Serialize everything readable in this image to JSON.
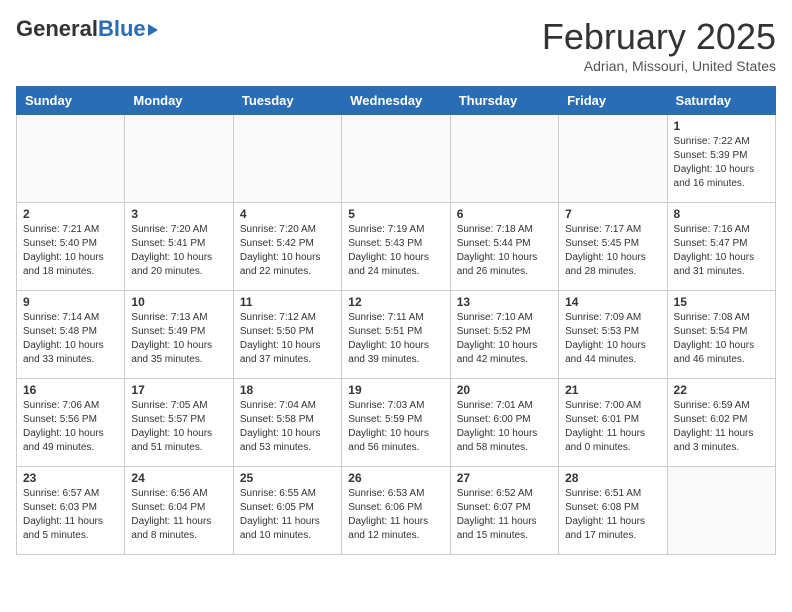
{
  "header": {
    "logo_general": "General",
    "logo_blue": "Blue",
    "month_title": "February 2025",
    "location": "Adrian, Missouri, United States"
  },
  "days_of_week": [
    "Sunday",
    "Monday",
    "Tuesday",
    "Wednesday",
    "Thursday",
    "Friday",
    "Saturday"
  ],
  "weeks": [
    [
      {
        "day": "",
        "info": ""
      },
      {
        "day": "",
        "info": ""
      },
      {
        "day": "",
        "info": ""
      },
      {
        "day": "",
        "info": ""
      },
      {
        "day": "",
        "info": ""
      },
      {
        "day": "",
        "info": ""
      },
      {
        "day": "1",
        "info": "Sunrise: 7:22 AM\nSunset: 5:39 PM\nDaylight: 10 hours and 16 minutes."
      }
    ],
    [
      {
        "day": "2",
        "info": "Sunrise: 7:21 AM\nSunset: 5:40 PM\nDaylight: 10 hours and 18 minutes."
      },
      {
        "day": "3",
        "info": "Sunrise: 7:20 AM\nSunset: 5:41 PM\nDaylight: 10 hours and 20 minutes."
      },
      {
        "day": "4",
        "info": "Sunrise: 7:20 AM\nSunset: 5:42 PM\nDaylight: 10 hours and 22 minutes."
      },
      {
        "day": "5",
        "info": "Sunrise: 7:19 AM\nSunset: 5:43 PM\nDaylight: 10 hours and 24 minutes."
      },
      {
        "day": "6",
        "info": "Sunrise: 7:18 AM\nSunset: 5:44 PM\nDaylight: 10 hours and 26 minutes."
      },
      {
        "day": "7",
        "info": "Sunrise: 7:17 AM\nSunset: 5:45 PM\nDaylight: 10 hours and 28 minutes."
      },
      {
        "day": "8",
        "info": "Sunrise: 7:16 AM\nSunset: 5:47 PM\nDaylight: 10 hours and 31 minutes."
      }
    ],
    [
      {
        "day": "9",
        "info": "Sunrise: 7:14 AM\nSunset: 5:48 PM\nDaylight: 10 hours and 33 minutes."
      },
      {
        "day": "10",
        "info": "Sunrise: 7:13 AM\nSunset: 5:49 PM\nDaylight: 10 hours and 35 minutes."
      },
      {
        "day": "11",
        "info": "Sunrise: 7:12 AM\nSunset: 5:50 PM\nDaylight: 10 hours and 37 minutes."
      },
      {
        "day": "12",
        "info": "Sunrise: 7:11 AM\nSunset: 5:51 PM\nDaylight: 10 hours and 39 minutes."
      },
      {
        "day": "13",
        "info": "Sunrise: 7:10 AM\nSunset: 5:52 PM\nDaylight: 10 hours and 42 minutes."
      },
      {
        "day": "14",
        "info": "Sunrise: 7:09 AM\nSunset: 5:53 PM\nDaylight: 10 hours and 44 minutes."
      },
      {
        "day": "15",
        "info": "Sunrise: 7:08 AM\nSunset: 5:54 PM\nDaylight: 10 hours and 46 minutes."
      }
    ],
    [
      {
        "day": "16",
        "info": "Sunrise: 7:06 AM\nSunset: 5:56 PM\nDaylight: 10 hours and 49 minutes."
      },
      {
        "day": "17",
        "info": "Sunrise: 7:05 AM\nSunset: 5:57 PM\nDaylight: 10 hours and 51 minutes."
      },
      {
        "day": "18",
        "info": "Sunrise: 7:04 AM\nSunset: 5:58 PM\nDaylight: 10 hours and 53 minutes."
      },
      {
        "day": "19",
        "info": "Sunrise: 7:03 AM\nSunset: 5:59 PM\nDaylight: 10 hours and 56 minutes."
      },
      {
        "day": "20",
        "info": "Sunrise: 7:01 AM\nSunset: 6:00 PM\nDaylight: 10 hours and 58 minutes."
      },
      {
        "day": "21",
        "info": "Sunrise: 7:00 AM\nSunset: 6:01 PM\nDaylight: 11 hours and 0 minutes."
      },
      {
        "day": "22",
        "info": "Sunrise: 6:59 AM\nSunset: 6:02 PM\nDaylight: 11 hours and 3 minutes."
      }
    ],
    [
      {
        "day": "23",
        "info": "Sunrise: 6:57 AM\nSunset: 6:03 PM\nDaylight: 11 hours and 5 minutes."
      },
      {
        "day": "24",
        "info": "Sunrise: 6:56 AM\nSunset: 6:04 PM\nDaylight: 11 hours and 8 minutes."
      },
      {
        "day": "25",
        "info": "Sunrise: 6:55 AM\nSunset: 6:05 PM\nDaylight: 11 hours and 10 minutes."
      },
      {
        "day": "26",
        "info": "Sunrise: 6:53 AM\nSunset: 6:06 PM\nDaylight: 11 hours and 12 minutes."
      },
      {
        "day": "27",
        "info": "Sunrise: 6:52 AM\nSunset: 6:07 PM\nDaylight: 11 hours and 15 minutes."
      },
      {
        "day": "28",
        "info": "Sunrise: 6:51 AM\nSunset: 6:08 PM\nDaylight: 11 hours and 17 minutes."
      },
      {
        "day": "",
        "info": ""
      }
    ]
  ]
}
